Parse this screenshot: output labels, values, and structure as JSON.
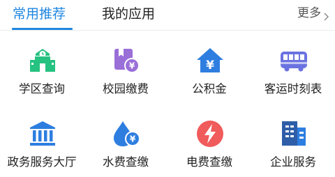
{
  "tabs": [
    {
      "label": "常用推荐",
      "active": true
    },
    {
      "label": "我的应用",
      "active": false
    }
  ],
  "more_label": "更多",
  "colors": {
    "accent": "#1f86e0",
    "green": "#26c281",
    "purple": "#9a6fd8",
    "blue": "#2e7ee0",
    "red": "#f05b5b"
  },
  "apps": [
    {
      "label": "学区查询",
      "icon": "school-icon"
    },
    {
      "label": "校园缴费",
      "icon": "campus-payment-icon"
    },
    {
      "label": "公积金",
      "icon": "housing-fund-icon"
    },
    {
      "label": "客运时刻表",
      "icon": "bus-icon"
    },
    {
      "label": "政务服务大厅",
      "icon": "government-hall-icon"
    },
    {
      "label": "水费查缴",
      "icon": "water-drop-icon"
    },
    {
      "label": "电费查缴",
      "icon": "lightning-icon"
    },
    {
      "label": "企业服务",
      "icon": "enterprise-building-icon"
    }
  ]
}
